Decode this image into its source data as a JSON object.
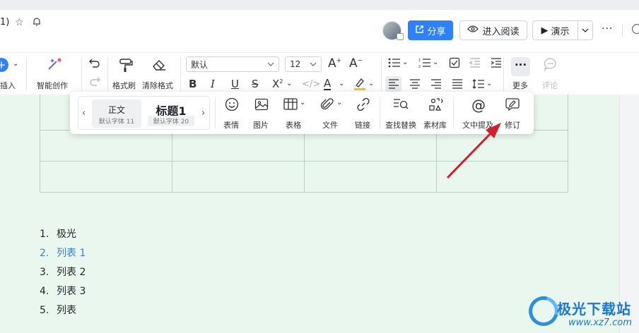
{
  "titlebar": {
    "title_fragment": "1)",
    "share_label": "分享",
    "read_label": "进入阅读",
    "present_label": "演示",
    "more_label": "···"
  },
  "toolbar": {
    "insert_label": "插入",
    "ai_label": "智能创作",
    "format_painter_label": "格式刷",
    "clear_format_label": "清除格式",
    "font_family": "默认",
    "font_size": "12",
    "more_label": "更多",
    "comment_label": "评论"
  },
  "popup": {
    "styles": [
      {
        "name": "正文",
        "sub": "默认字体 11"
      },
      {
        "name": "标题1",
        "sub": "默认字体 20"
      }
    ],
    "tools": [
      {
        "label": "表情"
      },
      {
        "label": "图片"
      },
      {
        "label": "表格"
      },
      {
        "label": "文件"
      },
      {
        "label": "链接"
      },
      {
        "label": "查找替换"
      },
      {
        "label": "素材库"
      },
      {
        "label": "文中提及"
      },
      {
        "label": "修订"
      }
    ]
  },
  "document": {
    "list": [
      {
        "num": "1.",
        "text": "极光"
      },
      {
        "num": "2.",
        "text": "列表 1"
      },
      {
        "num": "3.",
        "text": "列表 2"
      },
      {
        "num": "4.",
        "text": "列表 3"
      },
      {
        "num": "5.",
        "text": "列表"
      }
    ]
  },
  "watermark": {
    "title": "极光下载站",
    "url": "www.xz7.com"
  },
  "colors": {
    "accent": "#2f80ff",
    "doc_background": "#eaf7ee",
    "arrow": "#d0202a"
  }
}
